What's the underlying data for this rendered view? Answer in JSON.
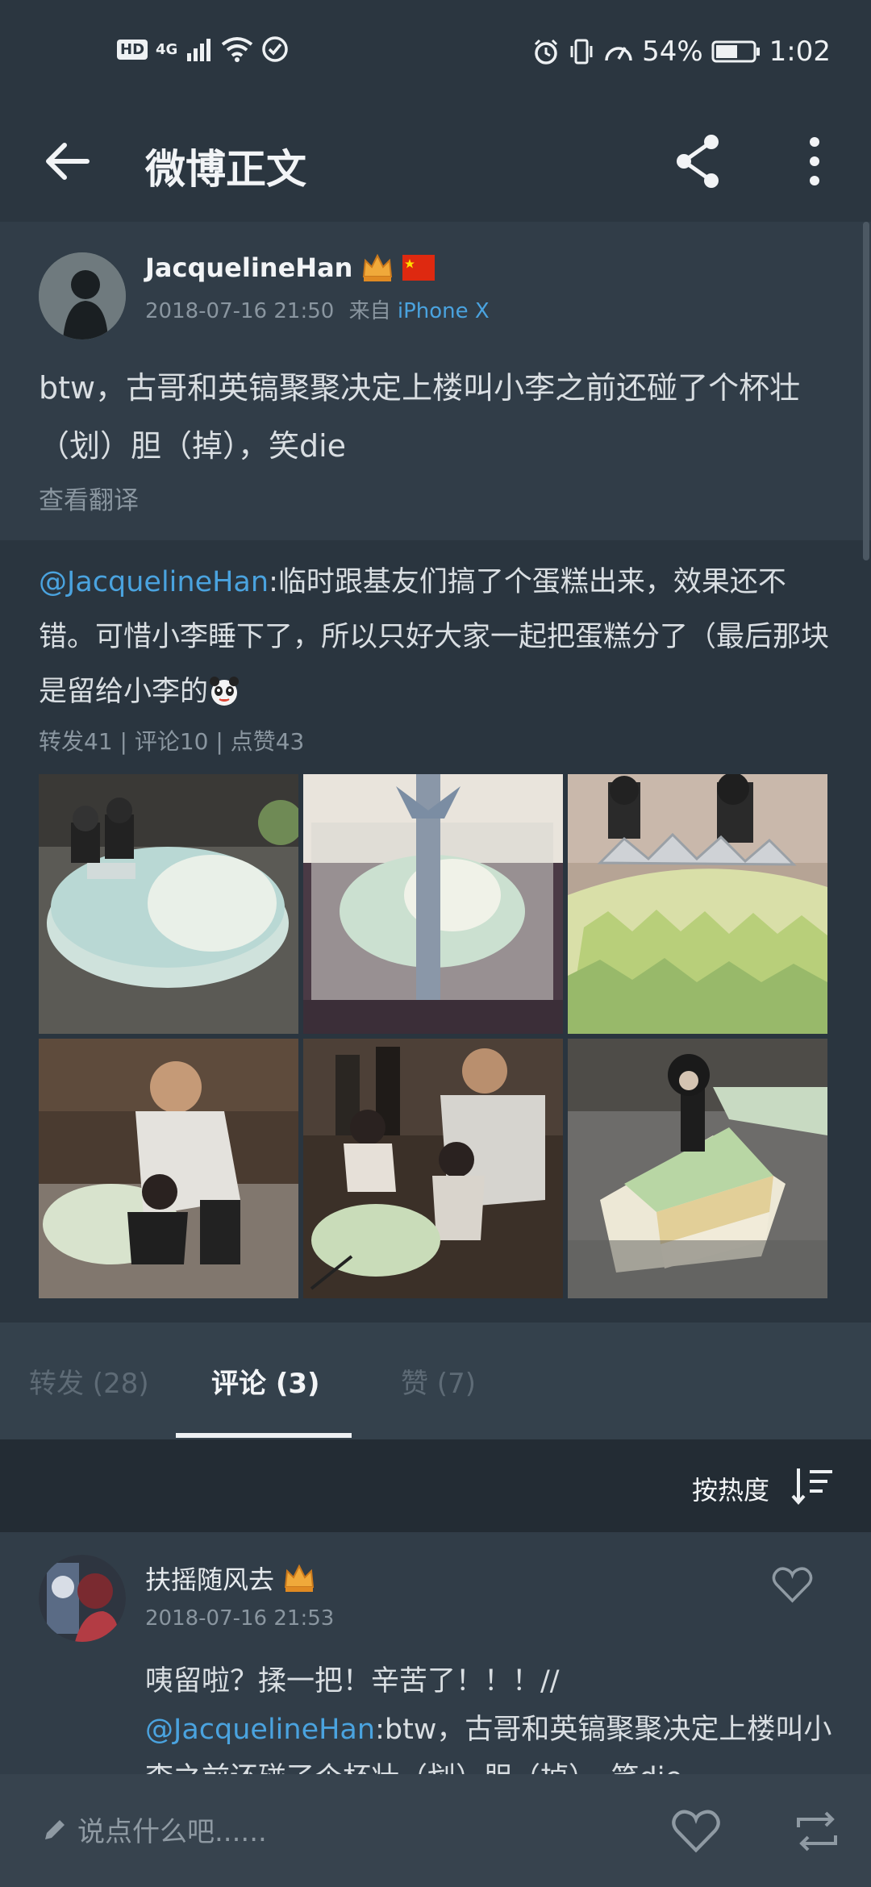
{
  "status_bar": {
    "hd": "HD",
    "network": "4G",
    "battery": "54%",
    "time": "1:02"
  },
  "appbar": {
    "title": "微博正文"
  },
  "post": {
    "author": "JacquelineHan",
    "datetime": "2018-07-16 21:50",
    "source_prefix": "来自",
    "source": "iPhone X",
    "text": "btw，古哥和英镐聚聚决定上楼叫小李之前还碰了个杯壮（划）胆（掉），笑die",
    "translate": "查看翻译"
  },
  "repost": {
    "mention": "@JacquelineHan",
    "text": ":临时跟基友们搞了个蛋糕出来，效果还不错。可惜小李睡下了，所以只好大家一起把蛋糕分了（最后那块是留给小李的",
    "stats": "转发41 | 评论10 | 点赞43",
    "photos": 6
  },
  "tabs": {
    "repost": "转发 (28)",
    "comment": "评论 (3)",
    "like": "赞 (7)"
  },
  "sort": {
    "label": "按热度"
  },
  "comment": {
    "name": "扶摇随风去",
    "time": "2018-07-16 21:53",
    "text_prefix": "咦留啦？揉一把！辛苦了！！！//",
    "mention": "@JacquelineHan",
    "text_rest": ":btw，古哥和英镐聚聚决定上楼叫小李之前还碰了个杯壮（划）胆（掉），笑die"
  },
  "bottom": {
    "compose_placeholder": "说点什么吧......"
  },
  "colors": {
    "accent_link": "#4aa3df",
    "bg": "#2a353f"
  }
}
